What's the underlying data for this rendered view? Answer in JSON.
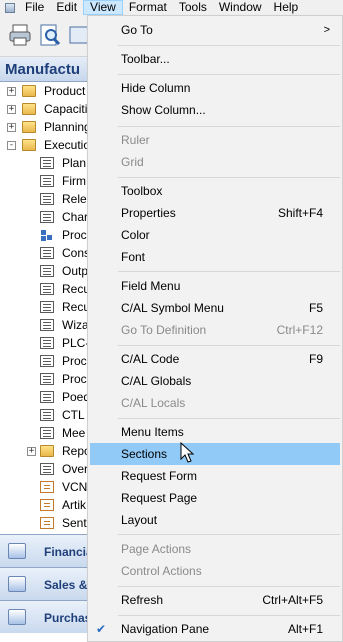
{
  "menubar": {
    "items": [
      "File",
      "Edit",
      "View",
      "Format",
      "Tools",
      "Window",
      "Help"
    ]
  },
  "nav": {
    "title": "Manufactu",
    "tree": [
      {
        "label": "Product",
        "type": "folder",
        "exp": "+"
      },
      {
        "label": "Capaciti",
        "type": "folder",
        "exp": "+"
      },
      {
        "label": "Planning",
        "type": "folder",
        "exp": "+"
      },
      {
        "label": "Executio",
        "type": "folder",
        "exp": "-"
      },
      {
        "label": "Plan",
        "type": "form"
      },
      {
        "label": "Firm",
        "type": "form"
      },
      {
        "label": "Rele",
        "type": "form"
      },
      {
        "label": "Char",
        "type": "form"
      },
      {
        "label": "Proc",
        "type": "flow"
      },
      {
        "label": "Cons",
        "type": "form"
      },
      {
        "label": "Outp",
        "type": "form"
      },
      {
        "label": "Recu",
        "type": "form"
      },
      {
        "label": "Recu",
        "type": "form"
      },
      {
        "label": "Wiza",
        "type": "form"
      },
      {
        "label": "PLC-",
        "type": "form"
      },
      {
        "label": "Proc",
        "type": "form"
      },
      {
        "label": "Proc",
        "type": "form"
      },
      {
        "label": "Poed",
        "type": "form"
      },
      {
        "label": "CTL",
        "type": "form"
      },
      {
        "label": "Mee",
        "type": "form"
      },
      {
        "label": "Repo",
        "type": "folder",
        "exp": "+"
      },
      {
        "label": "Over",
        "type": "form"
      },
      {
        "label": "VCN",
        "type": "report"
      },
      {
        "label": "Artik",
        "type": "report"
      },
      {
        "label": "Sent",
        "type": "report"
      }
    ],
    "buttons": [
      "Financia",
      "Sales &",
      "Purchas"
    ]
  },
  "menu": {
    "items": [
      {
        "label": "Go To",
        "shortcut": "",
        "disabled": false,
        "submenu": true
      },
      {
        "label": "Toolbar...",
        "shortcut": "",
        "disabled": false
      },
      {
        "label": "Hide Column",
        "shortcut": "",
        "disabled": false
      },
      {
        "label": "Show Column...",
        "shortcut": "",
        "disabled": false
      },
      {
        "label": "Ruler",
        "shortcut": "",
        "disabled": true
      },
      {
        "label": "Grid",
        "shortcut": "",
        "disabled": true
      },
      {
        "label": "Toolbox",
        "shortcut": "",
        "disabled": false
      },
      {
        "label": "Properties",
        "shortcut": "Shift+F4",
        "disabled": false
      },
      {
        "label": "Color",
        "shortcut": "",
        "disabled": false
      },
      {
        "label": "Font",
        "shortcut": "",
        "disabled": false
      },
      {
        "label": "Field Menu",
        "shortcut": "",
        "disabled": false
      },
      {
        "label": "C/AL Symbol Menu",
        "shortcut": "F5",
        "disabled": false
      },
      {
        "label": "Go To Definition",
        "shortcut": "Ctrl+F12",
        "disabled": true
      },
      {
        "label": "C/AL Code",
        "shortcut": "F9",
        "disabled": false
      },
      {
        "label": "C/AL Globals",
        "shortcut": "",
        "disabled": false
      },
      {
        "label": "C/AL Locals",
        "shortcut": "",
        "disabled": true
      },
      {
        "label": "Menu Items",
        "shortcut": "",
        "disabled": false
      },
      {
        "label": "Sections",
        "shortcut": "",
        "disabled": false,
        "highlighted": true
      },
      {
        "label": "Request Form",
        "shortcut": "",
        "disabled": false
      },
      {
        "label": "Request Page",
        "shortcut": "",
        "disabled": false
      },
      {
        "label": "Layout",
        "shortcut": "",
        "disabled": false
      },
      {
        "label": "Page Actions",
        "shortcut": "",
        "disabled": true
      },
      {
        "label": "Control Actions",
        "shortcut": "",
        "disabled": true
      },
      {
        "label": "Refresh",
        "shortcut": "Ctrl+Alt+F5",
        "disabled": false
      },
      {
        "label": "Navigation Pane",
        "shortcut": "Alt+F1",
        "disabled": false,
        "checked": true
      }
    ],
    "submenu_arrow": ">",
    "check_mark": "✔"
  },
  "colors": {
    "highlight": "#91c9f7",
    "nav_header_text": "#1f3f7a",
    "disabled_text": "#8a8a8a"
  }
}
